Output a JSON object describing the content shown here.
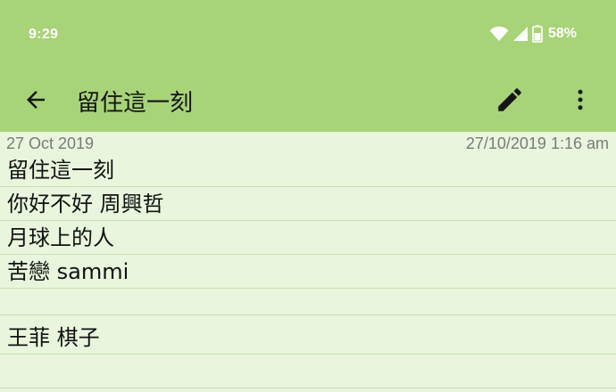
{
  "status_bar": {
    "time": "9:29",
    "battery_percent": "58%",
    "icons": [
      "wifi-icon",
      "cell-signal-icon",
      "battery-icon"
    ]
  },
  "app_bar": {
    "title": "留住這一刻",
    "icons": [
      "back-arrow-icon",
      "pencil-icon",
      "more-vert-icon"
    ]
  },
  "note": {
    "date": "27 Oct 2019",
    "timestamp": "27/10/2019 1:16 am",
    "lines": [
      "留住這一刻",
      "你好不好 周興哲",
      "月球上的人",
      "苦戀 sammi",
      "",
      "王菲 棋子",
      ""
    ]
  },
  "colors": {
    "header": "#a7d476",
    "background": "#e9f6dd",
    "rule_line": "#c6e0b0"
  }
}
